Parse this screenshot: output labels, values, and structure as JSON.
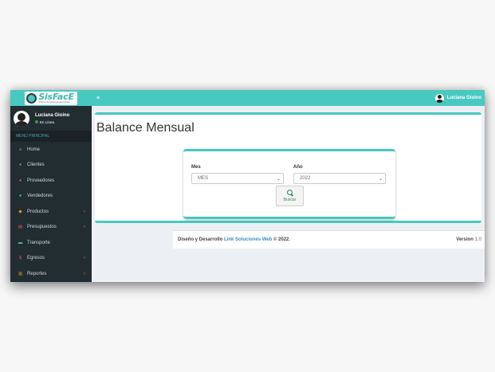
{
  "app": {
    "logo_text": "SisFacE",
    "logo_subtitle": "Sistema de Facturación Electrónica"
  },
  "user": {
    "name": "Luciana Gioino",
    "status": "En Línea"
  },
  "sidebar": {
    "menu_header": "MENÚ PRINCIPAL",
    "items": [
      {
        "label": "Home",
        "icon": "home-icon",
        "icon_glyph": "⌂",
        "icon_color": "#d0d7da",
        "has_chevron": false
      },
      {
        "label": "Clientes",
        "icon": "users-icon",
        "icon_glyph": "●",
        "icon_color": "#4caf50",
        "has_chevron": false
      },
      {
        "label": "Proveedores",
        "icon": "truck-users-icon",
        "icon_glyph": "●",
        "icon_color": "#e05a4a",
        "has_chevron": false
      },
      {
        "label": "Vendedores",
        "icon": "sellers-icon",
        "icon_glyph": "●",
        "icon_color": "#48c9c0",
        "has_chevron": false
      },
      {
        "label": "Productos",
        "icon": "products-icon",
        "icon_glyph": "◆",
        "icon_color": "#f39c12",
        "has_chevron": true
      },
      {
        "label": "Presupuestos",
        "icon": "budget-icon",
        "icon_glyph": "▤",
        "icon_color": "#e05a4a",
        "has_chevron": true
      },
      {
        "label": "Transporte",
        "icon": "transport-icon",
        "icon_glyph": "▬",
        "icon_color": "#48c9c0",
        "has_chevron": false
      },
      {
        "label": "Egresos",
        "icon": "dollar-icon",
        "icon_glyph": "$",
        "icon_color": "#e05a4a",
        "has_chevron": true
      },
      {
        "label": "Reportes",
        "icon": "chart-icon",
        "icon_glyph": "▥",
        "icon_color": "#f39c12",
        "has_chevron": true
      }
    ]
  },
  "topbar": {
    "menu_toggle": "≡",
    "user_name": "Luciana Gioino"
  },
  "main": {
    "title": "Balance Mensual",
    "form": {
      "month_label": "Mes",
      "month_value": "MES",
      "year_label": "Año",
      "year_value": "2022",
      "search_button": "Buscar"
    }
  },
  "footer": {
    "prefix": "Diseño y Desarrollo",
    "link": "Link Soluciones Web",
    "suffix": "© 2022.",
    "version_label": "Version",
    "version_number": "1.0"
  },
  "colors": {
    "accent": "#48c9c0",
    "sidebar_bg": "#222d32",
    "link": "#3c8dbc"
  }
}
